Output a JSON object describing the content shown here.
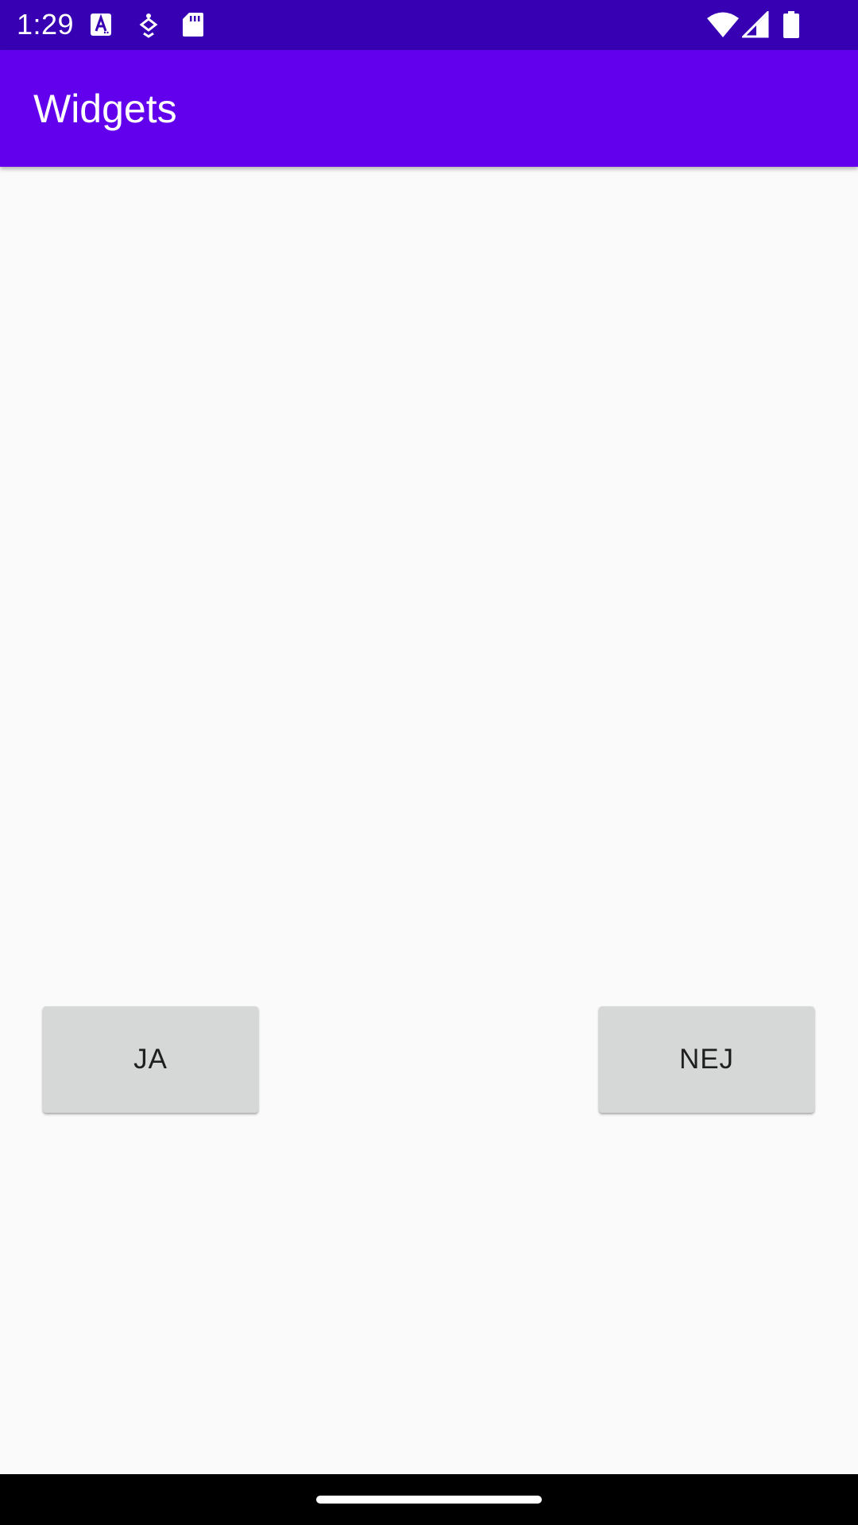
{
  "status_bar": {
    "time": "1:29",
    "left_icons": [
      "font-download-icon",
      "accessibility-icon",
      "sd-card-icon"
    ],
    "right_icons": [
      "wifi-icon",
      "cellular-signal-icon",
      "battery-icon"
    ]
  },
  "app_bar": {
    "title": "Widgets"
  },
  "buttons": {
    "ja_label": "JA",
    "nej_label": "NEJ"
  },
  "colors": {
    "status_bar": "#3700b3",
    "app_bar": "#6200ee",
    "background": "#fafafa",
    "button": "#d6d7d7"
  }
}
